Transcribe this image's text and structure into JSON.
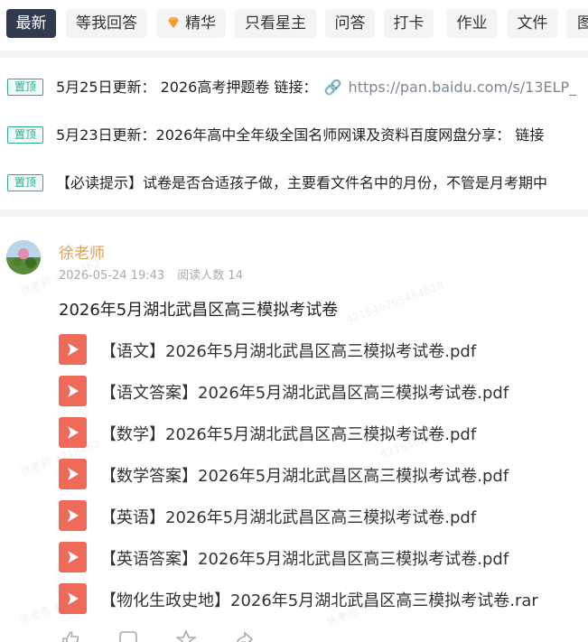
{
  "tabs": [
    {
      "label": "最新",
      "active": true
    },
    {
      "label": "等我回答"
    },
    {
      "label": "精华",
      "icon": "gem-icon"
    },
    {
      "label": "只看星主"
    },
    {
      "label": "问答"
    },
    {
      "label": "打卡"
    },
    {
      "label": "作业"
    },
    {
      "label": "文件"
    },
    {
      "label": "图"
    }
  ],
  "pinned": [
    {
      "badge": "置顶",
      "text": "5月25日更新： 2026高考押题卷 链接：",
      "link": "https://pan.baidu.com/s/13ELP_"
    },
    {
      "badge": "置顶",
      "text": "5月23日更新：2026年高中全年级全国名师网课及资料百度网盘分享： 链接"
    },
    {
      "badge": "置顶",
      "text": "【必读提示】试卷是否合适孩子做，主要看文件名中的月份，不管是月考期中"
    }
  ],
  "post": {
    "author": "徐老师",
    "datetime": "2026-05-24 19:43",
    "reads": "阅读人数 14",
    "title": "2026年5月湖北武昌区高三模拟考试卷",
    "files": [
      "【语文】2026年5月湖北武昌区高三模拟考试卷.pdf",
      "【语文答案】2026年5月湖北武昌区高三模拟考试卷.pdf",
      "【数学】2026年5月湖北武昌区高三模拟考试卷.pdf",
      "【数学答案】2026年5月湖北武昌区高三模拟考试卷.pdf",
      "【英语】2026年5月湖北武昌区高三模拟考试卷.pdf",
      "【英语答案】2026年5月湖北武昌区高三模拟考试卷.pdf",
      "【物化生政史地】2026年5月湖北武昌区高三模拟考试卷.rar"
    ]
  },
  "colors": {
    "active_tab": "#323a4f",
    "pin_green": "#2ea98f",
    "author": "#e0a057",
    "pdf_red": "#f06a5a"
  },
  "icons": [
    "link-icon",
    "pdf-file-icon",
    "like-icon",
    "comment-icon",
    "star-icon",
    "share-icon"
  ]
}
